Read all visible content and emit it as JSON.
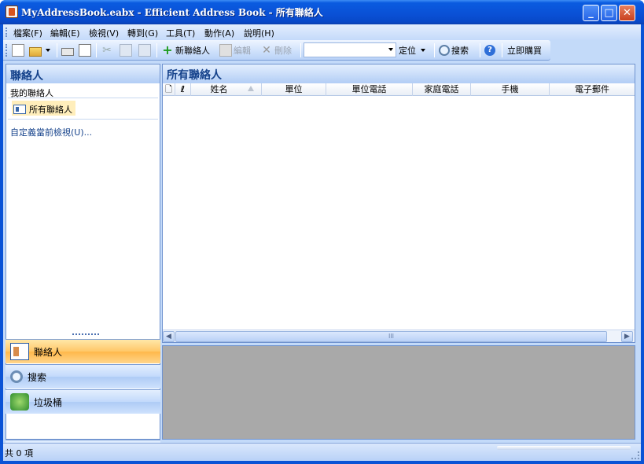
{
  "window": {
    "title": "MyAddressBook.eabx - Efficient Address Book - 所有聯絡人",
    "minimize": "_",
    "maximize": "□",
    "close": "✕"
  },
  "menu": [
    "檔案(F)",
    "編輯(E)",
    "檢視(V)",
    "轉到(G)",
    "工具(T)",
    "動作(A)",
    "說明(H)"
  ],
  "toolbar": {
    "new_contact": "新聯絡人",
    "edit": "編輯",
    "delete": "刪除",
    "locate": "定位",
    "search": "搜索",
    "buy_now": "立即購買",
    "combo_value": ""
  },
  "nav": {
    "header": "聯絡人",
    "group_label": "我的聯絡人",
    "selected_folder": "所有聯絡人",
    "customize_view_link": "自定義當前檢視(U)...",
    "buttons": {
      "contacts": "聯絡人",
      "search": "搜索",
      "trash": "垃圾桶"
    }
  },
  "list": {
    "header": "所有聯絡人",
    "columns": [
      "姓名",
      "單位",
      "單位電話",
      "家庭電話",
      "手機",
      "電子郵件"
    ],
    "scroll_thumb_label": "III"
  },
  "status": {
    "count_text": "共 0 項"
  }
}
